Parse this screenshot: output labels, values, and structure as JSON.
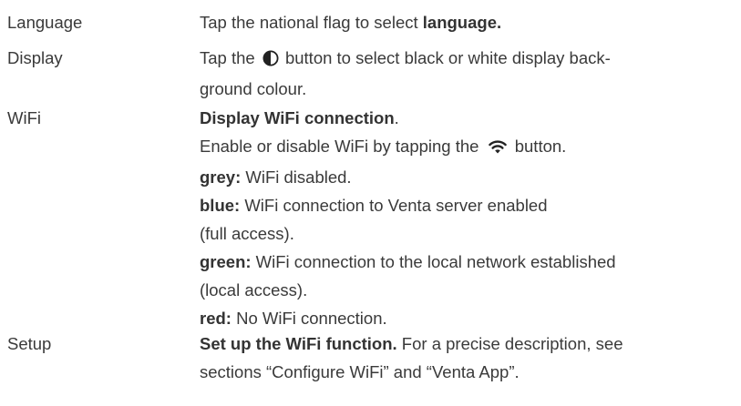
{
  "rows": {
    "language": {
      "term": "Language",
      "text_before": "Tap the national flag to select ",
      "bold": "language."
    },
    "display": {
      "term": "Display",
      "text_before": "Tap the",
      "icon": "contrast-icon",
      "text_after": "button to select black or white display back-",
      "line2": "ground colour."
    },
    "wifi": {
      "term": "WiFi",
      "title": "Display WiFi connection",
      "title_punct": ".",
      "enable_before": "Enable or disable WiFi by tapping the",
      "icon": "wifi-icon",
      "enable_after": "button.",
      "grey_label": "grey:",
      "grey_text": " WiFi disabled.",
      "blue_label": "blue:",
      "blue_text": " WiFi connection to Venta server enabled",
      "blue_text2": "(full access).",
      "green_label": "green:",
      "green_text": " WiFi connection to the local network established",
      "green_text2": "(local access).",
      "red_label": "red:",
      "red_text": " No WiFi connection."
    },
    "setup": {
      "term": "Setup",
      "bold": "Set up the WiFi function.",
      "text_after": " For a precise description, see",
      "line2": "sections “Configure WiFi” and “Venta App”."
    }
  },
  "colors": {
    "text": "#3a3a3a",
    "bold_text": "#333333",
    "background": "#ffffff"
  }
}
